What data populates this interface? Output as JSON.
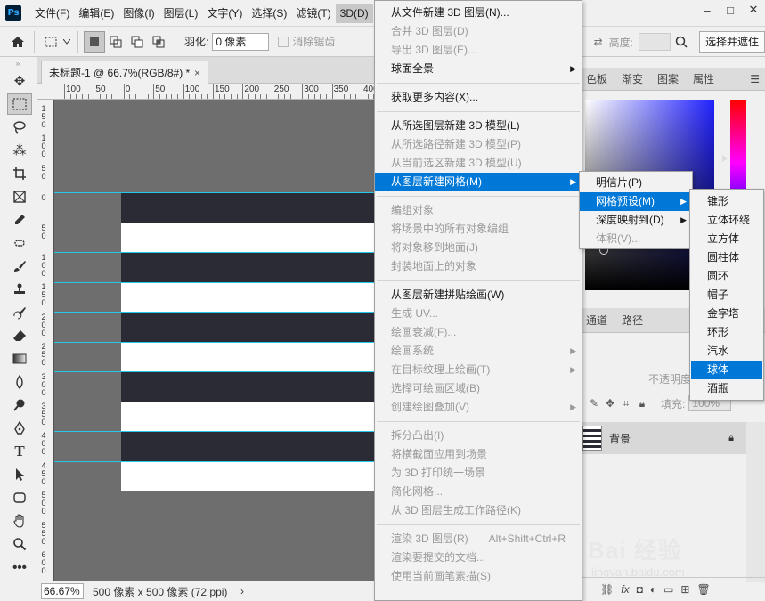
{
  "app": {
    "logo": "Ps"
  },
  "menubar": {
    "items": [
      "文件(F)",
      "编辑(E)",
      "图像(I)",
      "图层(L)",
      "文字(Y)",
      "选择(S)",
      "滤镜(T)",
      "3D(D)"
    ],
    "window_buttons": [
      "–",
      "□",
      "✕"
    ]
  },
  "options": {
    "feather_label": "羽化:",
    "feather_value": "0 像素",
    "antialias_label": "消除锯齿",
    "height_label": "高度:",
    "select_mask_button": "选择并遮住"
  },
  "document": {
    "tab_title": "未标题-1 @ 66.7%(RGB/8#) *",
    "tab_close": "×",
    "zoom": "66.67%",
    "info": "500 像素 x 500 像素 (72 ppi)",
    "status_arrow": "›",
    "ruler_h": [
      "100",
      "50",
      "0",
      "50",
      "100",
      "150",
      "200",
      "250",
      "300",
      "350",
      "400"
    ],
    "ruler_v": [
      "150",
      "100",
      "50",
      "0",
      "50",
      "100",
      "150",
      "200",
      "250",
      "300",
      "350",
      "400",
      "450",
      "500",
      "550",
      "600"
    ]
  },
  "canvas": {
    "dark_color": "#2b2b35",
    "light_color": "#ffffff",
    "guide_color": "#27c7e8"
  },
  "panels": {
    "color_tabs": [
      "色板",
      "渐变",
      "图案",
      "属性"
    ],
    "layers_tabs": [
      "通道",
      "路径"
    ],
    "opacity_label": "不透明度:",
    "fill_label": "填充:",
    "fill_value": "100%",
    "background_layer": "背景"
  },
  "menu3d": {
    "items": [
      {
        "label": "从文件新建 3D 图层(N)...",
        "disabled": false
      },
      {
        "label": "合并 3D 图层(D)",
        "disabled": true
      },
      {
        "label": "导出 3D 图层(E)...",
        "disabled": true
      },
      {
        "label": "球面全景",
        "disabled": false,
        "submenu": true
      },
      {
        "sep": true
      },
      {
        "label": "获取更多内容(X)...",
        "disabled": false
      },
      {
        "sep": true
      },
      {
        "label": "从所选图层新建 3D 模型(L)",
        "disabled": false
      },
      {
        "label": "从所选路径新建 3D 模型(P)",
        "disabled": true
      },
      {
        "label": "从当前选区新建 3D 模型(U)",
        "disabled": true
      },
      {
        "label": "从图层新建网格(M)",
        "disabled": false,
        "submenu": true,
        "highlighted": true
      },
      {
        "sep": true
      },
      {
        "label": "编组对象",
        "disabled": true
      },
      {
        "label": "将场景中的所有对象编组",
        "disabled": true
      },
      {
        "label": "将对象移到地面(J)",
        "disabled": true
      },
      {
        "label": "封装地面上的对象",
        "disabled": true
      },
      {
        "sep": true
      },
      {
        "label": "从图层新建拼贴绘画(W)",
        "disabled": false
      },
      {
        "label": "生成 UV...",
        "disabled": true
      },
      {
        "label": "绘画衰减(F)...",
        "disabled": true
      },
      {
        "label": "绘画系统",
        "disabled": true,
        "submenu": true
      },
      {
        "label": "在目标纹理上绘画(T)",
        "disabled": true,
        "submenu": true
      },
      {
        "label": "选择可绘画区域(B)",
        "disabled": true
      },
      {
        "label": "创建绘图叠加(V)",
        "disabled": true,
        "submenu": true
      },
      {
        "sep": true
      },
      {
        "label": "拆分凸出(I)",
        "disabled": true
      },
      {
        "label": "将横截面应用到场景",
        "disabled": true
      },
      {
        "label": "为 3D 打印统一场景",
        "disabled": true
      },
      {
        "label": "简化网格...",
        "disabled": true
      },
      {
        "label": "从 3D 图层生成工作路径(K)",
        "disabled": true
      },
      {
        "sep": true
      },
      {
        "label": "渲染 3D 图层(R)",
        "disabled": true,
        "shortcut": "Alt+Shift+Ctrl+R"
      },
      {
        "label": "渲染要提交的文档...",
        "disabled": true
      },
      {
        "label": "使用当前画笔素描(S)",
        "disabled": true
      }
    ]
  },
  "submenu_mesh": {
    "items": [
      {
        "label": "明信片(P)",
        "disabled": false
      },
      {
        "label": "网格预设(M)",
        "disabled": false,
        "submenu": true,
        "highlighted": true
      },
      {
        "label": "深度映射到(D)",
        "disabled": false,
        "submenu": true
      },
      {
        "label": "体积(V)...",
        "disabled": true
      }
    ]
  },
  "submenu_presets": {
    "items": [
      "锥形",
      "立体环绕",
      "立方体",
      "圆柱体",
      "圆环",
      "帽子",
      "金字塔",
      "环形",
      "汽水",
      "球体",
      "酒瓶"
    ],
    "highlighted_index": 9
  },
  "watermark": {
    "top": "Bai 经验",
    "bottom": "jingyan.baidu.com"
  }
}
